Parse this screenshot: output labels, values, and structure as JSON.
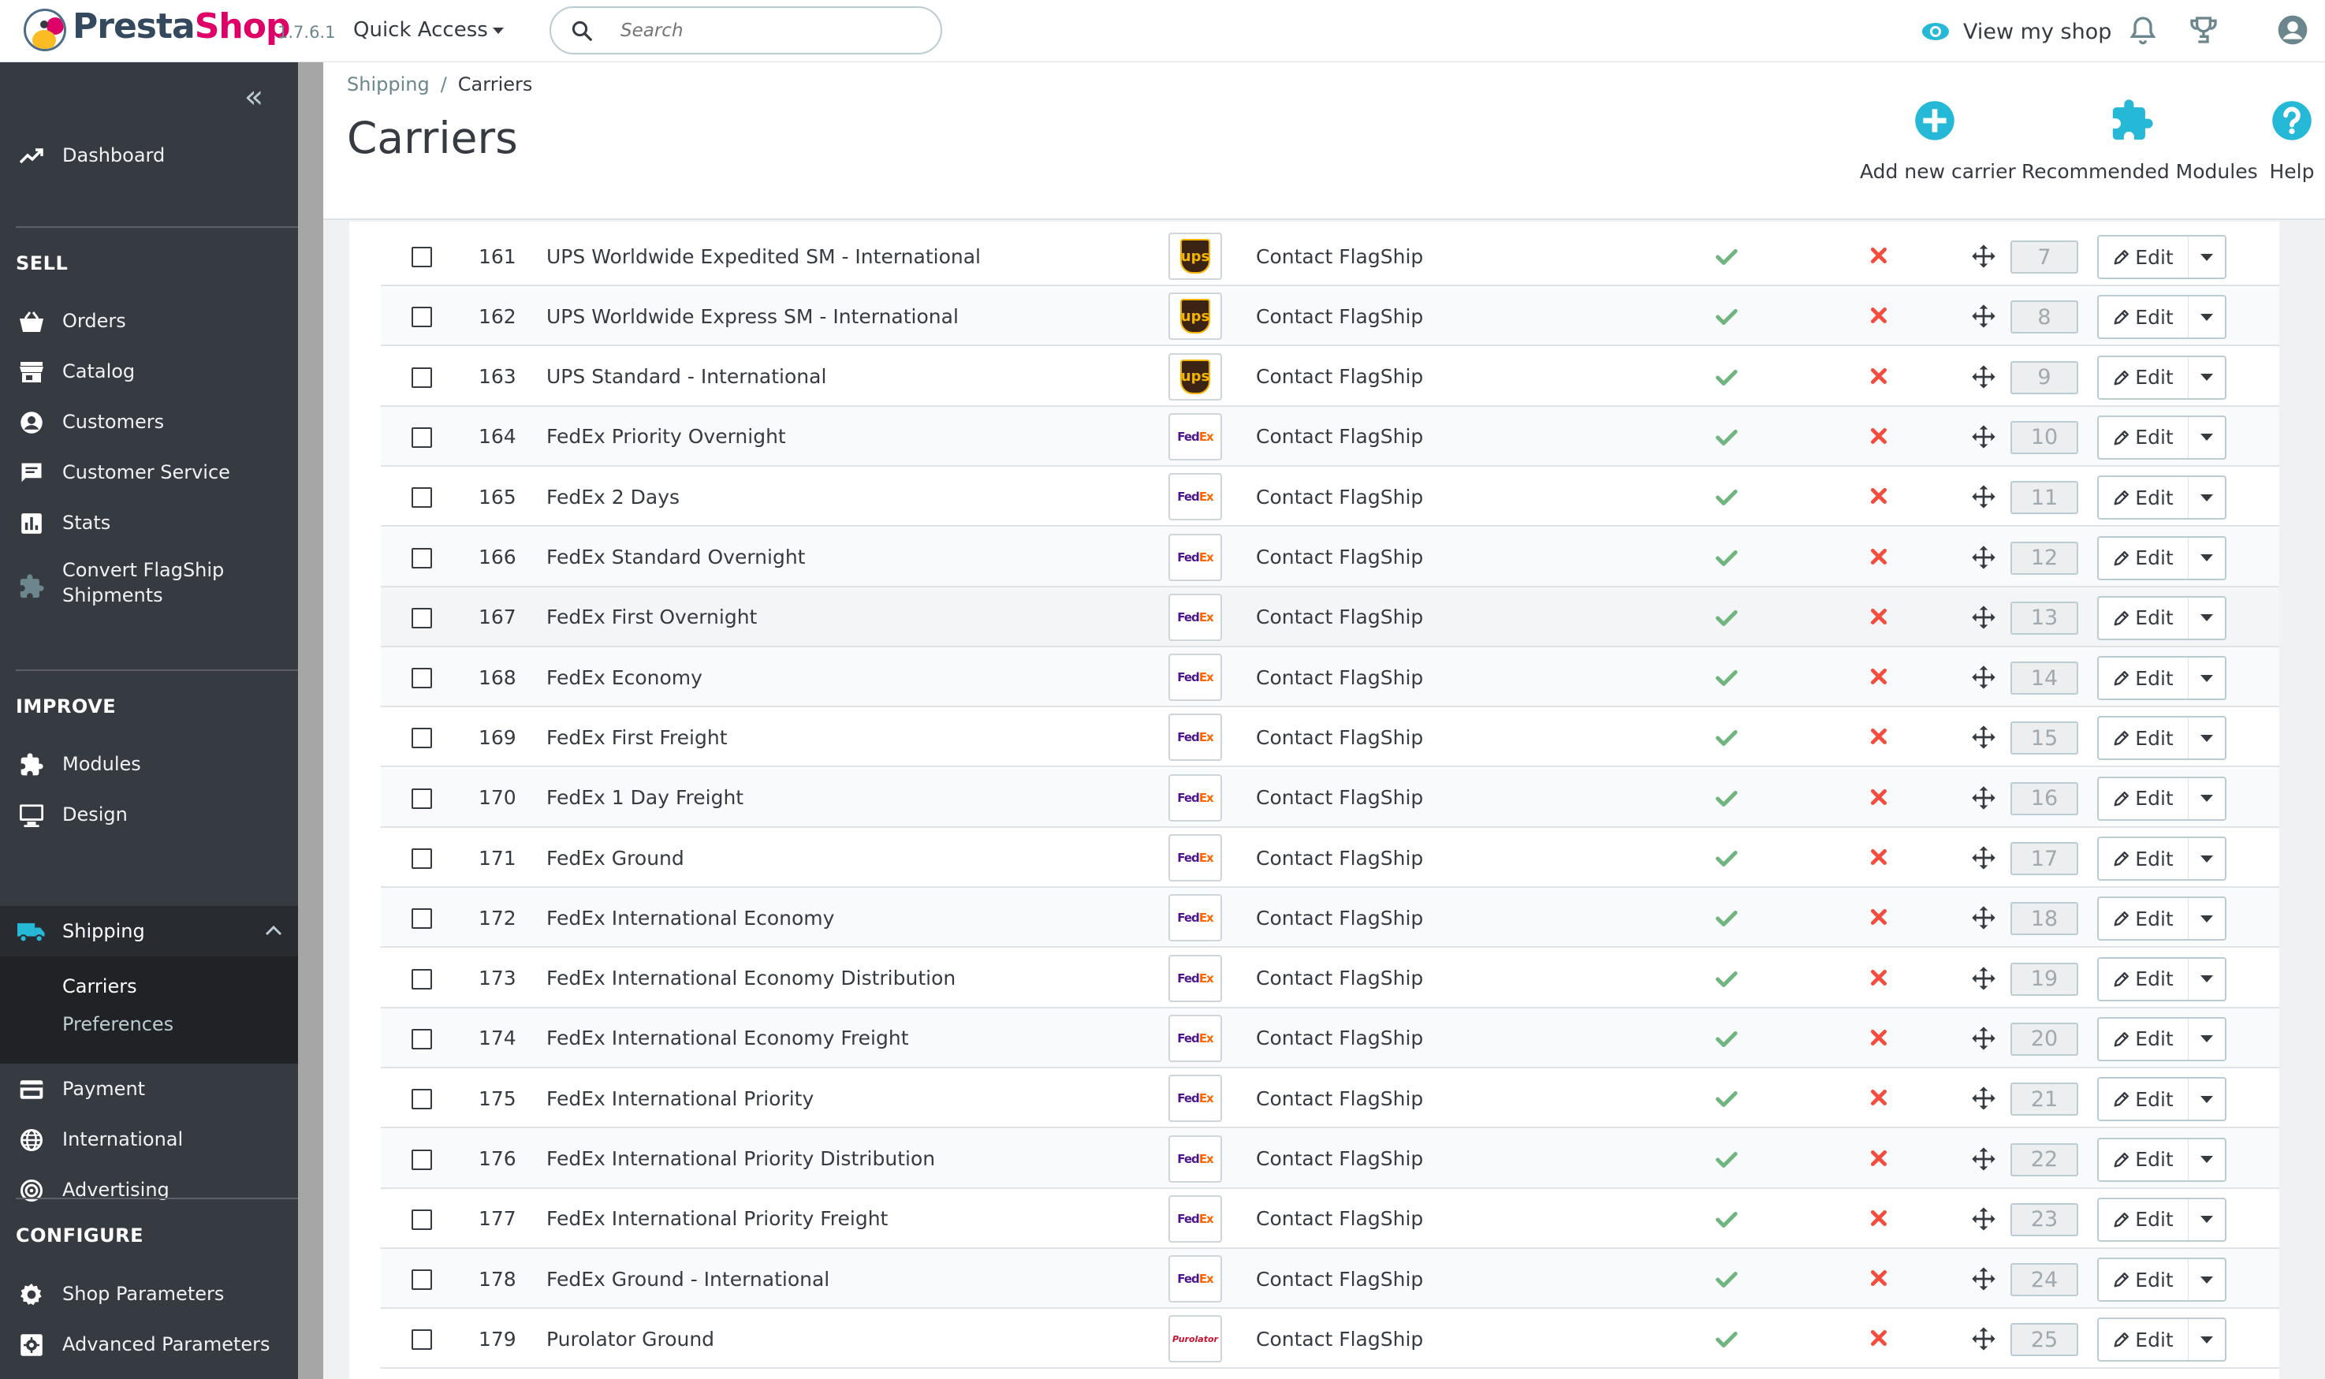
{
  "header": {
    "brand_part1": "Presta",
    "brand_part2": "Shop",
    "version": "1.7.6.1",
    "quick_access": "Quick Access",
    "search_placeholder": "Search",
    "view_shop": "View my shop",
    "icons": [
      "notifications-icon",
      "trophy-icon",
      "account-icon"
    ]
  },
  "sidebar": {
    "dashboard": "Dashboard",
    "section_sell": "SELL",
    "orders": "Orders",
    "catalog": "Catalog",
    "customers": "Customers",
    "customer_service": "Customer Service",
    "stats": "Stats",
    "convert_line1": "Convert FlagShip",
    "convert_line2": "Shipments",
    "section_improve": "IMPROVE",
    "modules": "Modules",
    "design": "Design",
    "shipping": "Shipping",
    "shipping_sub": [
      "Carriers",
      "Preferences"
    ],
    "payment": "Payment",
    "international": "International",
    "advertising": "Advertising",
    "section_configure": "CONFIGURE",
    "shop_parameters": "Shop Parameters",
    "advanced_parameters": "Advanced Parameters"
  },
  "breadcrumb": {
    "parent": "Shipping",
    "separator": "/",
    "current": "Carriers"
  },
  "page_title": "Carriers",
  "toolbar": {
    "add_new_carrier": "Add new carrier",
    "recommended_modules": "Recommended Modules",
    "help": "Help"
  },
  "colors": {
    "accent": "#25b9d7",
    "success": "#70b580",
    "danger": "#f54c3e",
    "sidebar": "#363a41"
  },
  "table": {
    "edit_label": "Edit",
    "rows": [
      {
        "id": "161",
        "name": "UPS Worldwide Expedited SM - International",
        "logo": "ups",
        "delay": "Contact FlagShip",
        "status": true,
        "free": false,
        "position": "7"
      },
      {
        "id": "162",
        "name": "UPS Worldwide Express SM - International",
        "logo": "ups",
        "delay": "Contact FlagShip",
        "status": true,
        "free": false,
        "position": "8"
      },
      {
        "id": "163",
        "name": "UPS Standard - International",
        "logo": "ups",
        "delay": "Contact FlagShip",
        "status": true,
        "free": false,
        "position": "9"
      },
      {
        "id": "164",
        "name": "FedEx Priority Overnight",
        "logo": "fedex",
        "delay": "Contact FlagShip",
        "status": true,
        "free": false,
        "position": "10"
      },
      {
        "id": "165",
        "name": "FedEx 2 Days",
        "logo": "fedex",
        "delay": "Contact FlagShip",
        "status": true,
        "free": false,
        "position": "11"
      },
      {
        "id": "166",
        "name": "FedEx Standard Overnight",
        "logo": "fedex",
        "delay": "Contact FlagShip",
        "status": true,
        "free": false,
        "position": "12"
      },
      {
        "id": "167",
        "name": "FedEx First Overnight",
        "logo": "fedex",
        "delay": "Contact FlagShip",
        "status": true,
        "free": false,
        "position": "13"
      },
      {
        "id": "168",
        "name": "FedEx Economy",
        "logo": "fedex",
        "delay": "Contact FlagShip",
        "status": true,
        "free": false,
        "position": "14"
      },
      {
        "id": "169",
        "name": "FedEx First Freight",
        "logo": "fedex",
        "delay": "Contact FlagShip",
        "status": true,
        "free": false,
        "position": "15"
      },
      {
        "id": "170",
        "name": "FedEx 1 Day Freight",
        "logo": "fedex",
        "delay": "Contact FlagShip",
        "status": true,
        "free": false,
        "position": "16"
      },
      {
        "id": "171",
        "name": "FedEx Ground",
        "logo": "fedex",
        "delay": "Contact FlagShip",
        "status": true,
        "free": false,
        "position": "17"
      },
      {
        "id": "172",
        "name": "FedEx International Economy",
        "logo": "fedex",
        "delay": "Contact FlagShip",
        "status": true,
        "free": false,
        "position": "18"
      },
      {
        "id": "173",
        "name": "FedEx International Economy Distribution",
        "logo": "fedex",
        "delay": "Contact FlagShip",
        "status": true,
        "free": false,
        "position": "19"
      },
      {
        "id": "174",
        "name": "FedEx International Economy Freight",
        "logo": "fedex",
        "delay": "Contact FlagShip",
        "status": true,
        "free": false,
        "position": "20"
      },
      {
        "id": "175",
        "name": "FedEx International Priority",
        "logo": "fedex",
        "delay": "Contact FlagShip",
        "status": true,
        "free": false,
        "position": "21"
      },
      {
        "id": "176",
        "name": "FedEx International Priority Distribution",
        "logo": "fedex",
        "delay": "Contact FlagShip",
        "status": true,
        "free": false,
        "position": "22"
      },
      {
        "id": "177",
        "name": "FedEx International Priority Freight",
        "logo": "fedex",
        "delay": "Contact FlagShip",
        "status": true,
        "free": false,
        "position": "23"
      },
      {
        "id": "178",
        "name": "FedEx Ground - International",
        "logo": "fedex",
        "delay": "Contact FlagShip",
        "status": true,
        "free": false,
        "position": "24"
      },
      {
        "id": "179",
        "name": "Purolator Ground",
        "logo": "purolator",
        "delay": "Contact FlagShip",
        "status": true,
        "free": false,
        "position": "25"
      }
    ]
  }
}
